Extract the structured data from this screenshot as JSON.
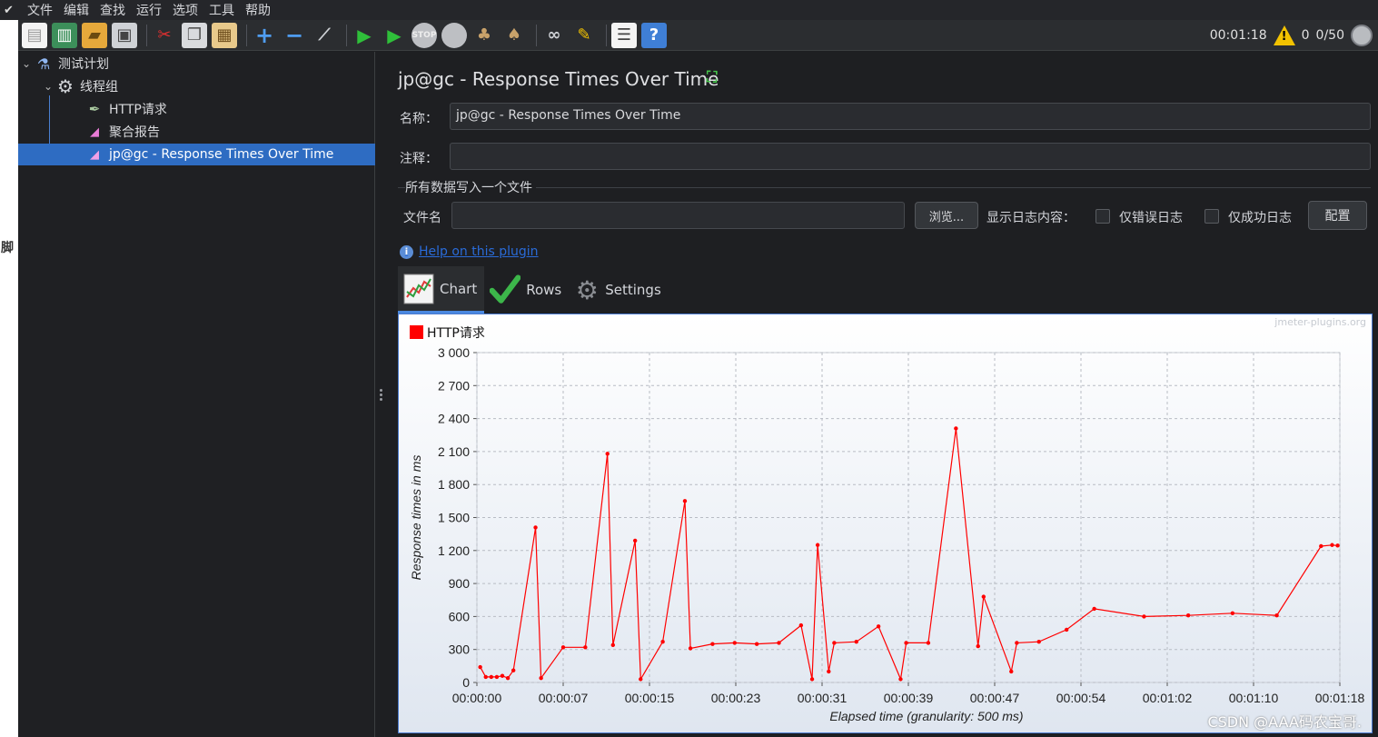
{
  "menu": [
    "文件",
    "编辑",
    "查找",
    "运行",
    "选项",
    "工具",
    "帮助"
  ],
  "left_strip_text": "脚",
  "toolbar": {
    "timer": "00:01:18",
    "warn_count": "0",
    "threads": "0/50"
  },
  "tree": {
    "items": [
      {
        "label": "测试计划",
        "icon": "flask-icon"
      },
      {
        "label": "线程组",
        "icon": "gear-icon"
      },
      {
        "label": "HTTP请求",
        "icon": "pipette-icon"
      },
      {
        "label": "聚合报告",
        "icon": "chart-report-icon"
      },
      {
        "label": "jp@gc - Response Times Over Time",
        "icon": "chart-report-icon"
      }
    ]
  },
  "panel": {
    "title": "jp@gc - Response Times Over Time",
    "name_label": "名称：",
    "name_value": "jp@gc - Response Times Over Time",
    "comment_label": "注释：",
    "comment_value": "",
    "group_title": "所有数据写入一个文件",
    "filename_label": "文件名",
    "filename_value": "",
    "browse_button": "浏览...",
    "log_label": "显示日志内容：",
    "errors_only_label": "仅错误日志",
    "success_only_label": "仅成功日志",
    "config_button": "配置",
    "help_link": "Help on this plugin"
  },
  "tabs": [
    "Chart",
    "Rows",
    "Settings"
  ],
  "chart_data": {
    "type": "line",
    "brand": "jmeter-plugins.org",
    "xlabel": "Elapsed time (granularity: 500 ms)",
    "ylabel": "Response times in ms",
    "ylim": [
      0,
      3000
    ],
    "yticks": [
      "3 000",
      "2 700",
      "2 400",
      "2 100",
      "1 800",
      "1 500",
      "1 200",
      "900",
      "600",
      "300",
      "0"
    ],
    "xtick_labels": [
      "00:00:00",
      "00:00:07",
      "00:00:15",
      "00:00:23",
      "00:00:31",
      "00:00:39",
      "00:00:47",
      "00:00:54",
      "00:01:02",
      "00:01:10",
      "00:01:18"
    ],
    "xlim_seconds": [
      0,
      78
    ],
    "color": "#ff0000",
    "series": [
      {
        "name": "HTTP请求",
        "x_seconds": [
          0.3,
          0.8,
          1.3,
          1.8,
          2.3,
          2.8,
          3.3,
          5.3,
          5.8,
          7.8,
          9.8,
          11.8,
          12.3,
          14.3,
          14.8,
          16.8,
          18.8,
          19.3,
          21.3,
          23.3,
          25.3,
          27.3,
          29.3,
          30.3,
          30.8,
          31.8,
          32.3,
          34.3,
          36.3,
          38.3,
          38.8,
          40.8,
          43.3,
          45.3,
          45.8,
          48.3,
          48.8,
          50.8,
          53.3,
          55.8,
          60.3,
          64.3,
          68.3,
          72.3,
          76.3,
          77.3,
          77.8
        ],
        "values": [
          140,
          50,
          50,
          50,
          60,
          40,
          110,
          1410,
          40,
          320,
          320,
          2080,
          340,
          1290,
          30,
          370,
          1650,
          310,
          350,
          360,
          350,
          360,
          520,
          30,
          1250,
          100,
          360,
          370,
          510,
          30,
          360,
          360,
          2310,
          330,
          780,
          100,
          360,
          370,
          480,
          670,
          600,
          610,
          630,
          610,
          1240,
          1250,
          1245
        ]
      }
    ]
  }
}
